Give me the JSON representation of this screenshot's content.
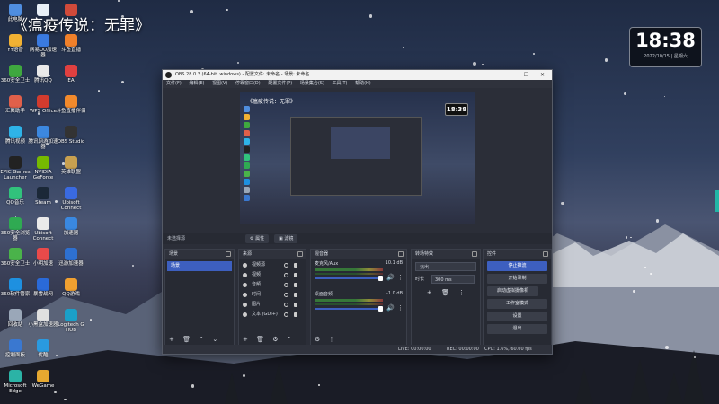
{
  "overlay_title": "《瘟疫传说：无罪》",
  "clock": {
    "time": "18:38",
    "date": "2022/10/15 | 星期六"
  },
  "desktop_icons": [
    {
      "label": "此电脑",
      "col": 0,
      "row": 0,
      "color": "#4f8ee0"
    },
    {
      "label": "",
      "col": 1,
      "row": 0,
      "color": "#e8f0f8"
    },
    {
      "label": "",
      "col": 2,
      "row": 0,
      "color": "#d04a3a"
    },
    {
      "label": "YY语音",
      "col": 0,
      "row": 1,
      "color": "#f1b133"
    },
    {
      "label": "网易UU加速器",
      "col": 1,
      "row": 1,
      "color": "#3a7ae0"
    },
    {
      "label": "斗鱼直播",
      "col": 2,
      "row": 1,
      "color": "#f0802a"
    },
    {
      "label": "360安全卫士",
      "col": 0,
      "row": 2,
      "color": "#3fa83f"
    },
    {
      "label": "腾讯QQ",
      "col": 1,
      "row": 2,
      "color": "#e9e9e9"
    },
    {
      "label": "EA",
      "col": 2,
      "row": 2,
      "color": "#e04040"
    },
    {
      "label": "汇聚助手",
      "col": 0,
      "row": 3,
      "color": "#e0604a"
    },
    {
      "label": "WPS Office",
      "col": 1,
      "row": 3,
      "color": "#d23b2e"
    },
    {
      "label": "斗鱼直播伴侣",
      "col": 2,
      "row": 3,
      "color": "#f28a2c"
    },
    {
      "label": "腾讯视频",
      "col": 0,
      "row": 4,
      "color": "#2eb3e8"
    },
    {
      "label": "腾讯网游加速器",
      "col": 1,
      "row": 4,
      "color": "#3c88e0"
    },
    {
      "label": "OBS Studio",
      "col": 2,
      "row": 4,
      "color": "#333"
    },
    {
      "label": "EPIC Games Launcher",
      "col": 0,
      "row": 5,
      "color": "#222"
    },
    {
      "label": "NVIDIA GeForce",
      "col": 1,
      "row": 5,
      "color": "#76b900"
    },
    {
      "label": "英雄联盟",
      "col": 2,
      "row": 5,
      "color": "#c8a050"
    },
    {
      "label": "QQ音乐",
      "col": 0,
      "row": 6,
      "color": "#31c27c"
    },
    {
      "label": "Steam",
      "col": 1,
      "row": 6,
      "color": "#1b2838"
    },
    {
      "label": "Ubisoft Connect",
      "col": 2,
      "row": 6,
      "color": "#3a6ae0"
    },
    {
      "label": "360安全浏览器",
      "col": 0,
      "row": 7,
      "color": "#2faa52"
    },
    {
      "label": "Ubisoft Connect",
      "col": 1,
      "row": 7,
      "color": "#eaeaea"
    },
    {
      "label": "加速器",
      "col": 2,
      "row": 7,
      "color": "#3a88e0"
    },
    {
      "label": "360安全卫士",
      "col": 0,
      "row": 8,
      "color": "#4ab34a"
    },
    {
      "label": "小明加速",
      "col": 1,
      "row": 8,
      "color": "#e94a4a"
    },
    {
      "label": "迅游加速器",
      "col": 2,
      "row": 8,
      "color": "#2e70d0"
    },
    {
      "label": "360软件管家",
      "col": 0,
      "row": 9,
      "color": "#1e90e0"
    },
    {
      "label": "暴雪战网",
      "col": 1,
      "row": 9,
      "color": "#2a6ad8"
    },
    {
      "label": "QQ游戏",
      "col": 2,
      "row": 9,
      "color": "#f0a030"
    },
    {
      "label": "回收站",
      "col": 0,
      "row": 10,
      "color": "#9aa7b8"
    },
    {
      "label": "小黑盒加速器",
      "col": 1,
      "row": 10,
      "color": "#e0e0e0"
    },
    {
      "label": "Logitech G HUB",
      "col": 2,
      "row": 10,
      "color": "#1aa0c8"
    },
    {
      "label": "控制面板",
      "col": 0,
      "row": 11,
      "color": "#3a78d0"
    },
    {
      "label": "优酷",
      "col": 1,
      "row": 11,
      "color": "#2a9ae0"
    },
    {
      "label": "Microsoft Edge",
      "col": 0,
      "row": 12,
      "color": "#2bb3a6"
    },
    {
      "label": "WeGame",
      "col": 1,
      "row": 12,
      "color": "#e6a830"
    }
  ],
  "obs": {
    "window_title": "OBS 28.0.3 (64-bit, windows) - 配置文件: 未命名 - 场景: 未命名",
    "window_controls": [
      "—",
      "☐",
      "✕"
    ],
    "menu": [
      "文件(F)",
      "编辑(E)",
      "视图(V)",
      "停靠窗口(D)",
      "配置文件(P)",
      "场景集合(S)",
      "工具(T)",
      "帮助(H)"
    ],
    "preview": {
      "title": "《瘟疫传说：无罪》",
      "clock": "18:38"
    },
    "source_bar": {
      "label": "未选择源",
      "props_button": "属性",
      "filters_button": "滤镜"
    },
    "scenes": {
      "title": "场景",
      "items": [
        "场景"
      ],
      "footer": [
        "+",
        "🗑",
        "⌃",
        "⌄"
      ]
    },
    "sources": {
      "title": "来源",
      "items": [
        "视频源",
        "视频",
        "音频",
        "时间",
        "图片",
        "文本 (GDI+)"
      ],
      "footer": [
        "+",
        "🗑",
        "⚙",
        "⌃",
        "⌄"
      ]
    },
    "mixer": {
      "title": "混音器",
      "channels": [
        {
          "name": "麦克风/Aux",
          "db": "10.1 dB",
          "level": 0.7
        },
        {
          "name": "桌面音频",
          "db": "-1.0 dB",
          "level": 0.75
        }
      ],
      "footer": [
        "⚙",
        "⋮"
      ]
    },
    "transitions": {
      "title": "转场特效",
      "type": "淡出",
      "duration_label": "时长",
      "duration": "300 ms",
      "footer": [
        "+",
        "🗑",
        "⋮"
      ]
    },
    "controls": {
      "title": "控件",
      "buttons": [
        "停止推流",
        "开始录制",
        "启动虚拟摄像机",
        "工作室模式",
        "设置",
        "退出"
      ]
    },
    "status": {
      "live": "LIVE: 00:00:00",
      "rec": "REC: 00:00:00",
      "cpu": "CPU: 1.6%, 60.00 fps"
    }
  }
}
